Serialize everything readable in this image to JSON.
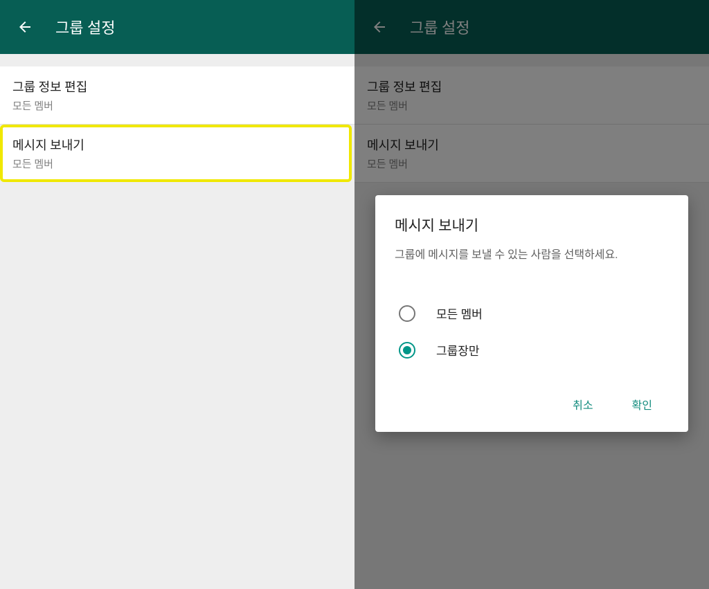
{
  "left_panel": {
    "header": {
      "title": "그룹 설정"
    },
    "settings": [
      {
        "title": "그룹 정보 편집",
        "subtitle": "모든 멤버"
      },
      {
        "title": "메시지 보내기",
        "subtitle": "모든 멤버"
      }
    ]
  },
  "right_panel": {
    "header": {
      "title": "그룹 설정"
    },
    "settings": [
      {
        "title": "그룹 정보 편집",
        "subtitle": "모든 멤버"
      },
      {
        "title": "메시지 보내기",
        "subtitle": "모든 멤버"
      }
    ],
    "dialog": {
      "title": "메시지 보내기",
      "description": "그룹에 메시지를 보낼 수 있는 사람을 선택하세요.",
      "options": [
        {
          "label": "모든 멤버",
          "selected": false
        },
        {
          "label": "그룹장만",
          "selected": true
        }
      ],
      "cancel": "취소",
      "confirm": "확인"
    }
  }
}
